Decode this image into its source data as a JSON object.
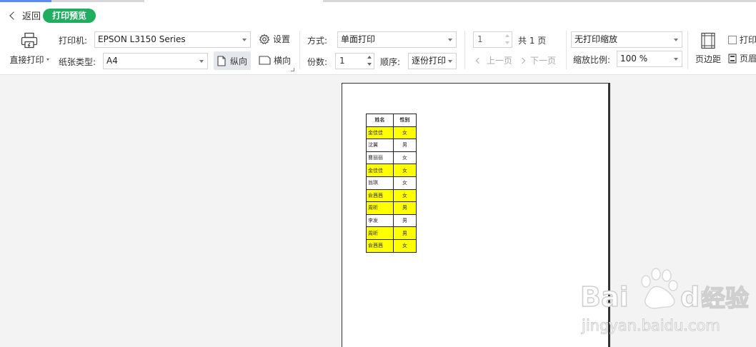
{
  "titlebar": {
    "back_label": "返回",
    "badge_label": "打印预览"
  },
  "toolbar": {
    "direct_print_label": "直接打印",
    "printer_label": "打印机:",
    "printer_value": "EPSON L3150 Series",
    "settings_label": "设置",
    "paper_label": "纸张类型:",
    "paper_value": "A4",
    "portrait_label": "纵向",
    "landscape_label": "横向",
    "mode_label": "方式:",
    "mode_value": "单面打印",
    "copies_label": "份数:",
    "copies_value": "1",
    "order_label": "顺序:",
    "order_value": "逐份打印",
    "page_value": "1",
    "total_pages": "共 1 页",
    "prev_page": "上一页",
    "next_page": "下一页",
    "scale_mode_value": "无打印缩放",
    "scale_ratio_label": "缩放比例:",
    "scale_ratio_value": "100 %",
    "margins_label": "页边距",
    "print_checkbox_label": "打印",
    "header_footer_label": "页眉"
  },
  "sheet": {
    "headers": [
      "姓名",
      "性别"
    ],
    "rows": [
      {
        "name": "金佳佳",
        "gender": "女",
        "highlight": true
      },
      {
        "name": "沈翼",
        "gender": "男",
        "highlight": false
      },
      {
        "name": "曹丽丽",
        "gender": "女",
        "highlight": false
      },
      {
        "name": "金佳佳",
        "gender": "女",
        "highlight": true
      },
      {
        "name": "翁琪",
        "gender": "女",
        "highlight": false
      },
      {
        "name": "俞茜茜",
        "gender": "女",
        "highlight": true
      },
      {
        "name": "周昕",
        "gender": "男",
        "highlight": true
      },
      {
        "name": "李发",
        "gender": "男",
        "highlight": false
      },
      {
        "name": "周昕",
        "gender": "男",
        "highlight": true
      },
      {
        "name": "俞茜茜",
        "gender": "女",
        "highlight": true
      }
    ]
  },
  "watermark": {
    "brand": "Bai",
    "brand2": "du",
    "cn": "经验",
    "url": "jingyan.baidu.com"
  },
  "colors": {
    "accent_green": "#1fad5f",
    "highlight_yellow": "#ffff00"
  }
}
